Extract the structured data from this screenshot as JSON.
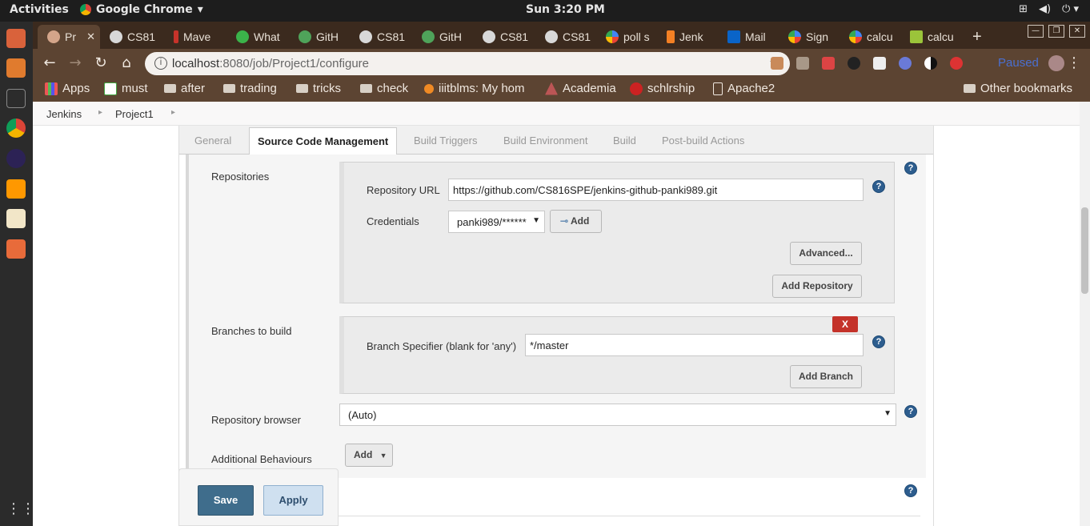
{
  "os_bar": {
    "activities": "Activities",
    "app_name": "Google Chrome",
    "clock": "Sun  3:20 PM"
  },
  "browser": {
    "tabs": [
      {
        "label": "Pr",
        "icon": "jenkins-icon",
        "active": true
      },
      {
        "label": "CS81",
        "icon": "github-icon"
      },
      {
        "label": "Mave",
        "icon": "maven-icon"
      },
      {
        "label": "What",
        "icon": "whatsapp-icon"
      },
      {
        "label": "GitH",
        "icon": "github-icon"
      },
      {
        "label": "CS81",
        "icon": "github-icon"
      },
      {
        "label": "GitH",
        "icon": "github-icon"
      },
      {
        "label": "CS81",
        "icon": "github-icon"
      },
      {
        "label": "CS81",
        "icon": "github-icon"
      },
      {
        "label": "poll s",
        "icon": "google-icon"
      },
      {
        "label": "Jenk",
        "icon": "stackoverflow-icon"
      },
      {
        "label": "Mail",
        "icon": "outlook-icon"
      },
      {
        "label": "Sign",
        "icon": "google-icon"
      },
      {
        "label": "calcu",
        "icon": "google-icon"
      },
      {
        "label": "calcu",
        "icon": "calc-icon"
      }
    ],
    "url_host": "localhost",
    "url_path": ":8080/job/Project1/configure",
    "profile_status": "Paused",
    "bookmarks": [
      {
        "label": "Apps",
        "icon": "apps-grid-icon"
      },
      {
        "label": "must",
        "icon": "site-icon"
      },
      {
        "label": "after",
        "icon": "folder-icon"
      },
      {
        "label": "trading",
        "icon": "folder-icon"
      },
      {
        "label": "tricks",
        "icon": "folder-icon"
      },
      {
        "label": "check",
        "icon": "folder-icon"
      },
      {
        "label": "iiitblms: My hom",
        "icon": "moodle-icon"
      },
      {
        "label": "Academia",
        "icon": "academia-icon"
      },
      {
        "label": "schlrship",
        "icon": "site-icon"
      },
      {
        "label": "Apache2",
        "icon": "page-icon"
      },
      {
        "label": "Other bookmarks",
        "icon": "folder-icon"
      }
    ]
  },
  "jenkins": {
    "breadcrumbs": [
      "Jenkins",
      "Project1"
    ],
    "tabs": [
      "General",
      "Source Code Management",
      "Build Triggers",
      "Build Environment",
      "Build",
      "Post-build Actions"
    ],
    "active_tab": "Source Code Management",
    "repositories_label": "Repositories",
    "repository_url_label": "Repository URL",
    "repository_url_value": "https://github.com/CS816SPE/jenkins-github-panki989.git",
    "credentials_label": "Credentials",
    "credentials_value": "panki989/******",
    "add_credentials_label": "Add",
    "advanced_label": "Advanced...",
    "add_repository_label": "Add Repository",
    "branches_label": "Branches to build",
    "delete_branch_label": "X",
    "branch_specifier_label": "Branch Specifier (blank for 'any')",
    "branch_specifier_value": "*/master",
    "add_branch_label": "Add Branch",
    "repository_browser_label": "Repository browser",
    "repository_browser_value": "(Auto)",
    "additional_behaviours_label": "Additional Behaviours",
    "add_behaviour_label": "Add",
    "save_label": "Save",
    "apply_label": "Apply",
    "help_glyph": "?"
  }
}
